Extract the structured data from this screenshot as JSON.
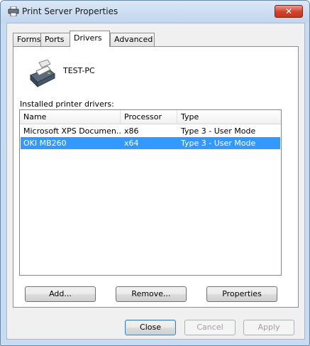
{
  "window": {
    "title": "Print Server Properties",
    "close_glyph": "✕"
  },
  "tabs": [
    {
      "label": "Forms",
      "active": false
    },
    {
      "label": "Ports",
      "active": false
    },
    {
      "label": "Drivers",
      "active": true
    },
    {
      "label": "Advanced",
      "active": false
    }
  ],
  "server": {
    "name": "TEST-PC",
    "icon": "printer-server-icon"
  },
  "drivers": {
    "label": "Installed printer drivers:",
    "columns": [
      "Name",
      "Processor",
      "Type"
    ],
    "rows": [
      {
        "name": "Microsoft XPS Documen...",
        "processor": "x86",
        "type": "Type 3 - User Mode",
        "selected": false
      },
      {
        "name": "OKI MB260",
        "processor": "x64",
        "type": "Type 3 - User Mode",
        "selected": true
      }
    ]
  },
  "buttons": {
    "add": "Add...",
    "remove": "Remove...",
    "properties": "Properties",
    "close": "Close",
    "cancel": "Cancel",
    "apply": "Apply"
  },
  "colors": {
    "selection": "#3399ff",
    "close_button": "#c9432b",
    "title_bar": "#c2d6ee"
  }
}
